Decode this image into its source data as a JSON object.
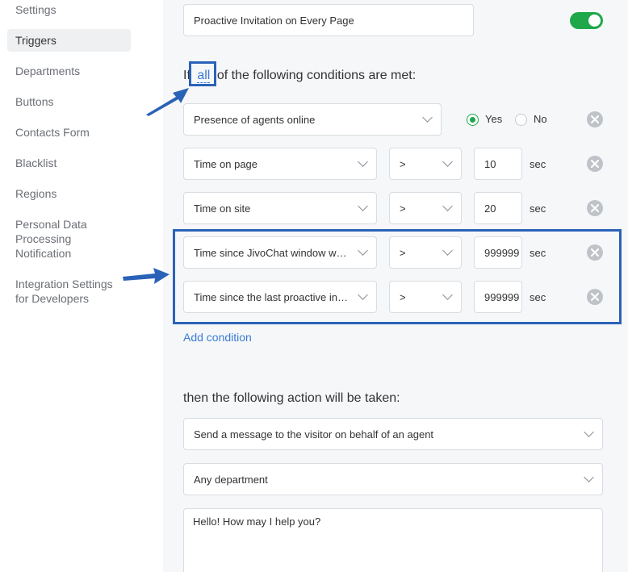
{
  "sidebar": {
    "items": [
      {
        "label": "Settings"
      },
      {
        "label": "Triggers"
      },
      {
        "label": "Departments"
      },
      {
        "label": "Buttons"
      },
      {
        "label": "Contacts Form"
      },
      {
        "label": "Blacklist"
      },
      {
        "label": "Regions"
      },
      {
        "label": "Personal Data Processing Notification"
      },
      {
        "label": "Integration Settings for Developers"
      }
    ],
    "active_item": "Triggers"
  },
  "trigger": {
    "name": "Proactive Invitation on Every Page",
    "enabled": true
  },
  "conditions": {
    "heading_prefix": "If",
    "match_mode": "all",
    "heading_suffix": "of the following conditions are met:",
    "presence": {
      "label": "Presence of agents online",
      "yes_label": "Yes",
      "no_label": "No",
      "selected": "Yes"
    },
    "rows": [
      {
        "label": "Time on page",
        "operator": ">",
        "value": "10",
        "unit": "sec"
      },
      {
        "label": "Time on site",
        "operator": ">",
        "value": "20",
        "unit": "sec"
      },
      {
        "label": "Time since JivoChat window wa…",
        "operator": ">",
        "value": "999999",
        "unit": "sec"
      },
      {
        "label": "Time since the last proactive in…",
        "operator": ">",
        "value": "999999",
        "unit": "sec"
      }
    ],
    "add_label": "Add condition"
  },
  "actions": {
    "heading": "then the following action will be taken:",
    "action_type": "Send a message to the visitor on behalf of an agent",
    "department": "Any department",
    "message": "Hello! How may I help you?"
  },
  "colors": {
    "accent_green": "#1ea84a",
    "link_blue": "#3a7bd5",
    "annotation_blue": "#2a62b8"
  }
}
